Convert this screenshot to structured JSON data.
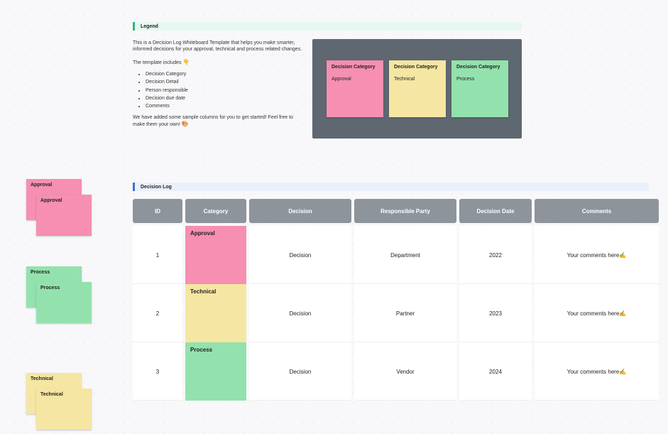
{
  "legend": {
    "title": "Legend",
    "intro": "This is a Decision Log Whiteboard Template that helps you make smarter, informed decisions for your approval, technical and process related changes.",
    "includes_label": "The template includes",
    "includes_emoji": "👇",
    "bullets": [
      "Decision Category",
      "Decision Detail",
      "Person responsible",
      "Decision due date",
      "Comments"
    ],
    "outro": "We have added some sample columns for you to get started! Feel free to make them your own!",
    "outro_emoji": "🎨",
    "notes": [
      {
        "title": "Decision Category",
        "subtitle": "Approval"
      },
      {
        "title": "Decision Category",
        "subtitle": "Technical"
      },
      {
        "title": "Decision Category",
        "subtitle": "Process"
      }
    ]
  },
  "log": {
    "title": "Decision Log",
    "headers": [
      "ID",
      "Category",
      "Decision",
      "Responsible Party",
      "Decision Date",
      "Comments"
    ],
    "rows": [
      {
        "id": "1",
        "category": "Approval",
        "decision": "Decision",
        "responsible": "Department",
        "date": "2022",
        "comments": "Your comments here",
        "emoji": "✍️"
      },
      {
        "id": "2",
        "category": "Technical",
        "decision": "Decision",
        "responsible": "Partner",
        "date": "2023",
        "comments": "Your comments here",
        "emoji": "✍️"
      },
      {
        "id": "3",
        "category": "Process",
        "decision": "Decision",
        "responsible": "Vendor",
        "date": "2024",
        "comments": "Your comments here",
        "emoji": "✍️"
      }
    ]
  },
  "stacks": [
    {
      "label": "Approval"
    },
    {
      "label": "Process"
    },
    {
      "label": "Technical"
    }
  ]
}
